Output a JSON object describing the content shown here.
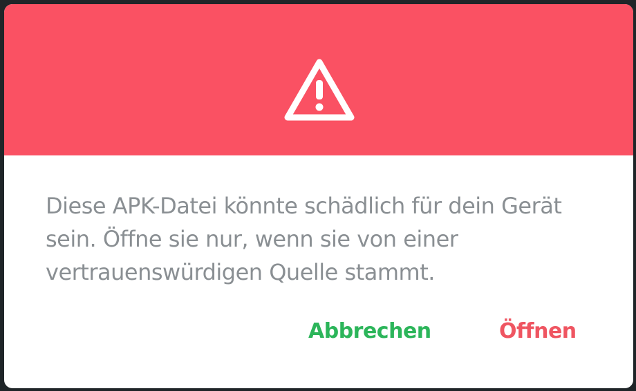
{
  "dialog": {
    "icon": "warning-triangle-icon",
    "message": "Diese APK-Datei könnte schädlich für dein Gerät sein. Öffne sie nur, wenn sie von einer vertrauenswürdigen Quelle stammt.",
    "cancel_label": "Abbrechen",
    "open_label": "Öffnen"
  },
  "colors": {
    "header": "#fa5163",
    "cancel": "#2cb55a",
    "open": "#ef5561",
    "message_text": "#8a8f93",
    "backdrop": "#1f2528"
  }
}
